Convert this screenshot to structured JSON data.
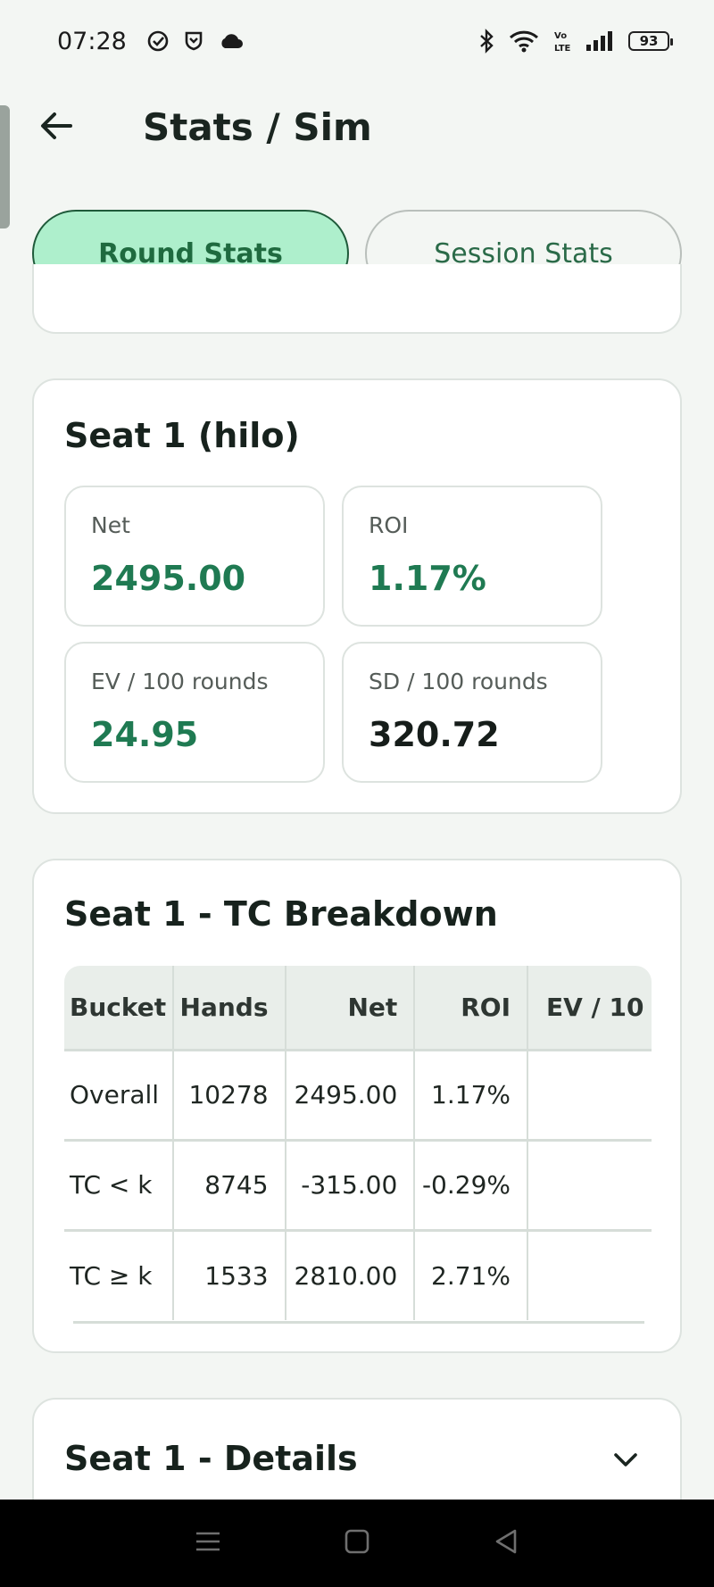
{
  "status_bar": {
    "time": "07:28",
    "battery": "93",
    "icons_left": [
      "check-circle-icon",
      "shield-icon",
      "cloud-icon"
    ],
    "icons_right": [
      "bluetooth-icon",
      "wifi-icon",
      "volte-icon",
      "signal-icon",
      "battery-icon"
    ]
  },
  "header": {
    "title": "Stats / Sim",
    "back_icon": "arrow-left-icon"
  },
  "tabs": [
    {
      "label": "Round Stats",
      "active": true
    },
    {
      "label": "Session Stats",
      "active": false
    }
  ],
  "summary_card": {
    "title": "Seat 1 (hilo)",
    "metrics": [
      {
        "label": "Net",
        "value": "2495.00",
        "tone": "positive"
      },
      {
        "label": "ROI",
        "value": "1.17%",
        "tone": "positive"
      },
      {
        "label": "EV / 100 rounds",
        "value": "24.95",
        "tone": "positive"
      },
      {
        "label": "SD / 100 rounds",
        "value": "320.72",
        "tone": "neutral"
      }
    ]
  },
  "breakdown_card": {
    "title": "Seat 1 - TC Breakdown",
    "columns": [
      "Bucket",
      "Hands",
      "Net",
      "ROI",
      "EV / 10"
    ],
    "rows": [
      [
        "Overall",
        "10278",
        "2495.00",
        "1.17%",
        ""
      ],
      [
        "TC < k",
        "8745",
        "-315.00",
        "-0.29%",
        ""
      ],
      [
        "TC ≥ k",
        "1533",
        "2810.00",
        "2.71%",
        ""
      ]
    ]
  },
  "details_card": {
    "title": "Seat 1 - Details",
    "toggle_icon": "chevron-down-icon"
  },
  "colors": {
    "accent": "#1f7a52",
    "tab_active_bg": "#aeefcc",
    "background": "#f3f6f3"
  }
}
